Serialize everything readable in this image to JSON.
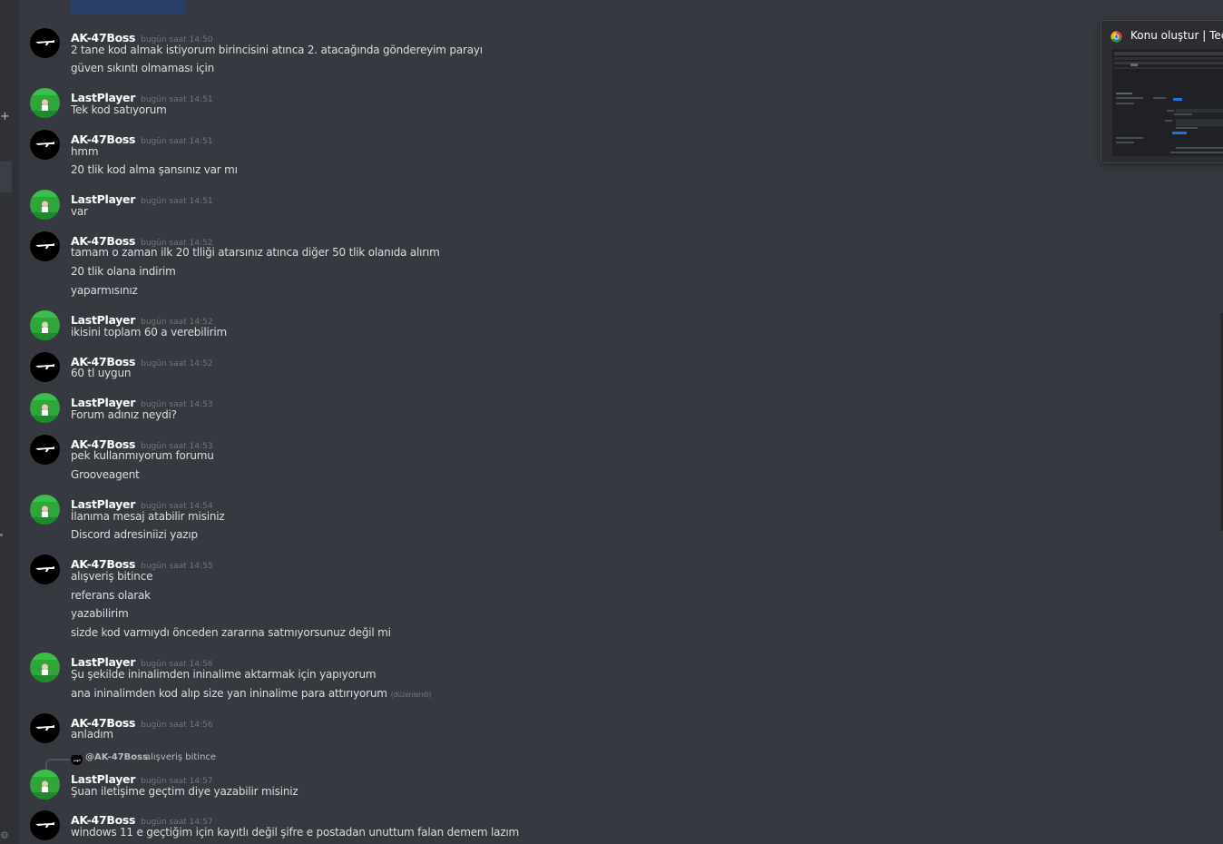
{
  "users": {
    "ak": {
      "name": "AK-47Boss"
    },
    "lp": {
      "name": "LastPlayer"
    }
  },
  "colors": {
    "background": "#36393f",
    "username": "#ffffff",
    "text": "#dcddde",
    "timestamp": "#72767d",
    "lp_avatar": "#2fa63a",
    "ak_avatar": "#000000"
  },
  "messages": [
    {
      "author": "AK-47Boss",
      "time": "bugün saat 14:50",
      "lines": [
        "2 tane kod almak istiyorum birincisini atınca 2. atacağında göndereyim parayı",
        "güven sıkıntı olmaması için"
      ]
    },
    {
      "author": "LastPlayer",
      "time": "bugün saat 14:51",
      "lines": [
        "Tek kod satıyorum"
      ]
    },
    {
      "author": "AK-47Boss",
      "time": "bugün saat 14:51",
      "lines": [
        "hmm",
        "20 tlik kod alma şansınız var mı"
      ]
    },
    {
      "author": "LastPlayer",
      "time": "bugün saat 14:51",
      "lines": [
        "var"
      ]
    },
    {
      "author": "AK-47Boss",
      "time": "bugün saat 14:52",
      "lines": [
        "tamam o zaman ilk 20 tlliği atarsınız atınca diğer 50 tlik olanıda alırım",
        "20 tlik olana indirim",
        "yaparmısınız"
      ]
    },
    {
      "author": "LastPlayer",
      "time": "bugün saat 14:52",
      "lines": [
        "ikisini toplam 60 a verebilirim"
      ]
    },
    {
      "author": "AK-47Boss",
      "time": "bugün saat 14:52",
      "lines": [
        "60 tl uygun"
      ]
    },
    {
      "author": "LastPlayer",
      "time": "bugün saat 14:53",
      "lines": [
        "Forum adınız neydi?"
      ]
    },
    {
      "author": "AK-47Boss",
      "time": "bugün saat 14:53",
      "lines": [
        "pek kullanmıyorum forumu",
        "Grooveagent"
      ]
    },
    {
      "author": "LastPlayer",
      "time": "bugün saat 14:54",
      "lines": [
        "İlanıma mesaj atabilir misiniz",
        "Discord adresiniizi yazıp"
      ]
    },
    {
      "author": "AK-47Boss",
      "time": "bugün saat 14:55",
      "lines": [
        "alışveriş bitince",
        "referans olarak",
        "yazabilirim",
        "sizde kod varmıydı önceden zararına satmıyorsunuz değil mi"
      ]
    },
    {
      "author": "LastPlayer",
      "time": "bugün saat 14:56",
      "lines": [
        "Şu şekilde ininalimden ininalime aktarmak için yapıyorum",
        "ana ininalimden kod alıp size yan ininalime para attırıyorum"
      ],
      "edited": "(düzenlendi)"
    },
    {
      "author": "AK-47Boss",
      "time": "bugün saat 14:56",
      "lines": [
        "anladım"
      ]
    },
    {
      "author": "LastPlayer",
      "time": "bugün saat 14:57",
      "lines": [
        "Şuan iletişime geçtim diye yazabilir misiniz"
      ],
      "reply": {
        "name": "@AK-47Boss",
        "text": "alışveriş bitince"
      }
    },
    {
      "author": "AK-47Boss",
      "time": "bugün saat 14:57",
      "lines": [
        "windows 11 e geçtiğim için kayıtlı değil şifre e postadan unuttum falan demem lazım"
      ]
    }
  ],
  "popup": {
    "title": "Konu oluştur | TechoStore",
    "icon": "chrome-icon"
  }
}
